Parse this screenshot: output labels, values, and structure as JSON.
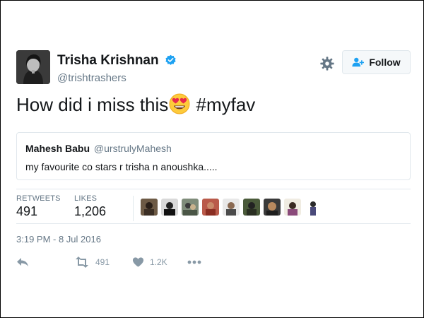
{
  "tweet": {
    "author": {
      "display_name": "Trisha Krishnan",
      "handle": "@trishtrashers",
      "verified": true
    },
    "follow_button_label": "Follow",
    "text_before_emoji": "How did i miss this",
    "emoji": "heart-eyes-emoji",
    "text_after_emoji": " #myfav",
    "quoted_tweet": {
      "author_name": "Mahesh Babu",
      "author_handle": "@urstrulyMahesh",
      "text": "my favourite co stars r trisha n anoushka....."
    },
    "stats": {
      "retweets_label": "RETWEETS",
      "retweets_value": "491",
      "likes_label": "LIKES",
      "likes_value": "1,206"
    },
    "liker_avatar_count_shown": 9,
    "timestamp": "3:19 PM - 8 Jul 2016",
    "actions": {
      "reply_icon": "reply-icon",
      "retweet_icon": "retweet-icon",
      "retweet_count": "491",
      "like_icon": "heart-icon",
      "like_count": "1.2K",
      "more_icon": "more-icon"
    }
  },
  "colors": {
    "verified_blue": "#1da1f2",
    "secondary_text": "#657786",
    "action_gray": "#8899a6",
    "border": "#e1e8ed"
  }
}
